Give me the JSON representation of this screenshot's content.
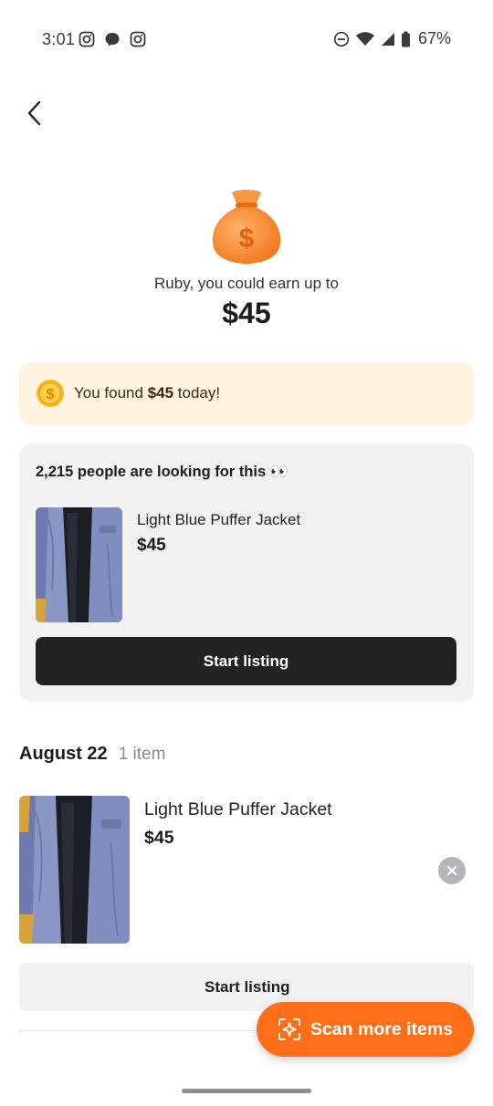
{
  "status_bar": {
    "time": "3:01",
    "battery": "67%"
  },
  "hero": {
    "earn_label": "Ruby, you could earn up to",
    "earn_amount": "$45"
  },
  "found_banner": {
    "prefix": "You found ",
    "amount": "$45",
    "suffix": " today!"
  },
  "demand_card": {
    "title": "2,215 people are looking for this 👀",
    "item_name": "Light Blue Puffer Jacket",
    "item_price": "$45",
    "button_label": "Start listing"
  },
  "history": {
    "date": "August 22",
    "count": "1 item",
    "item": {
      "name": "Light Blue Puffer Jacket",
      "price": "$45"
    },
    "button_label": "Start listing"
  },
  "fab": {
    "label": "Scan more items"
  },
  "colors": {
    "accent": "#ff6f18",
    "banner_bg": "#fff4e0",
    "card_bg": "#f2f2f3",
    "dark_button": "#222223"
  },
  "icons": [
    "instagram-icon",
    "chat-bubble-icon",
    "do-not-disturb-icon",
    "wifi-icon",
    "signal-icon",
    "battery-icon",
    "back-arrow-icon",
    "money-bag-icon",
    "coin-icon",
    "close-icon",
    "scan-icon"
  ]
}
